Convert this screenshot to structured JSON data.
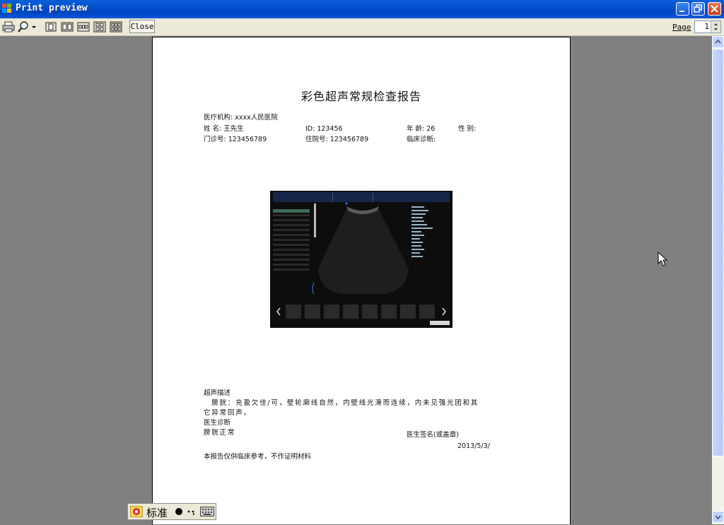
{
  "window": {
    "title": "Print preview"
  },
  "toolbar": {
    "close_label": "Close",
    "page_label": "Page",
    "page_value": "1"
  },
  "report": {
    "title": "彩色超声常规检查报告",
    "institution": "医疗机构: xxxx人民医院",
    "name": "姓 名: 王先生",
    "id": "ID: 123456",
    "age": "年 龄: 26",
    "sex": "性 别:",
    "outpatient_no": "门诊号: 123456789",
    "inpatient_no": "住院号: 123456789",
    "clinical_diagnosis": "临床诊断:",
    "description_heading": "超声描述",
    "description_line1": "　膀胱：充盈欠佳/可，壁轮廓线自然，内壁线光滑而连续，内未见强光团和其",
    "description_line2": "它异常回声。",
    "diagnosis_heading": "医生诊断",
    "diagnosis_text": "膀胱正常",
    "signature": "医生签名(或盖章)",
    "date": "2013/5/3/",
    "disclaimer": "本报告仅供临床参考，不作证明材料"
  },
  "ime": {
    "mode_label": "标准"
  },
  "colors": {
    "titlebar": "#0350d0",
    "toolbar": "#ece9d8",
    "preview_bg": "#808080",
    "paper": "#ffffff"
  },
  "icons": [
    "windows-app-icon",
    "printer-icon",
    "zoom-icon",
    "dropdown-arrow-icon",
    "one-page-icon",
    "two-pages-icon",
    "three-pages-icon",
    "four-pages-icon",
    "six-pages-icon",
    "minimize-icon",
    "restore-icon",
    "close-icon",
    "spin-up-icon",
    "spin-down-icon",
    "scroll-up-icon",
    "scroll-down-icon",
    "mouse-cursor-icon"
  ]
}
